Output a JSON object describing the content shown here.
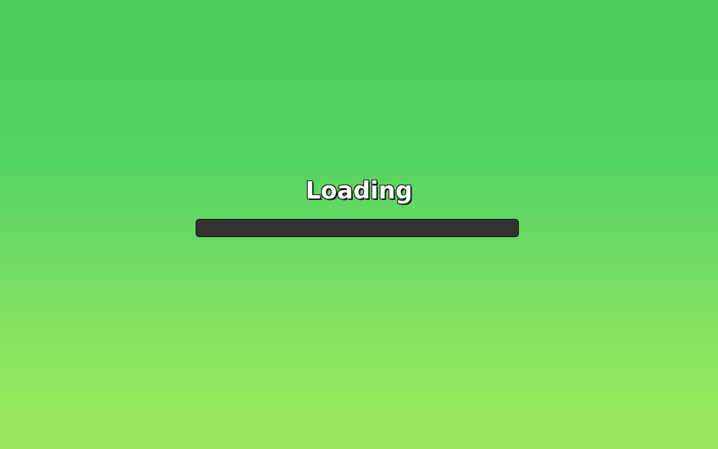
{
  "loading": {
    "title": "Loading",
    "progress": 0
  },
  "colors": {
    "background_top": "#49cf5f",
    "background_bottom": "#9be85f",
    "bar_track": "#333333",
    "title_fill": "#ffffff",
    "title_outline": "#111111"
  }
}
